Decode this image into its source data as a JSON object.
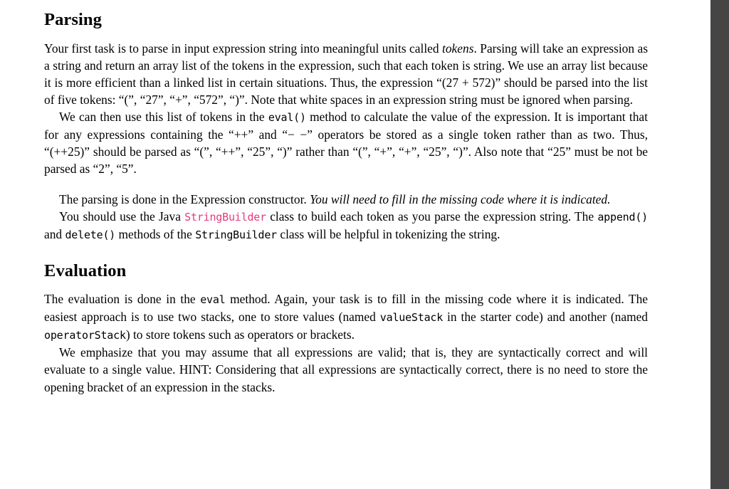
{
  "document": {
    "sections": [
      {
        "heading": "Parsing",
        "paragraphs": [
          {
            "id": "p1",
            "runs": [
              {
                "t": "Your first task is to parse in input expression string into meaningful units called ",
                "s": "normal"
              },
              {
                "t": "tokens",
                "s": "italic"
              },
              {
                "t": ". Parsing will take an expression as a string and return an array list of the tokens in the expression, such that each token is string. We use an array list because it is more efficient than a linked list in certain situations. Thus, the expression “(27 + 572)” should be parsed into the list of five tokens: “(”, “27”, “+”, “572”, “)”. Note that white spaces in an expression string must be ignored when parsing.",
                "s": "normal"
              }
            ]
          },
          {
            "id": "p2",
            "runs": [
              {
                "t": "We can then use this list of tokens in the ",
                "s": "normal"
              },
              {
                "t": "eval()",
                "s": "mono"
              },
              {
                "t": " method to calculate the value of the expression. It is important that for any expressions containing the “++” and “− −” operators be stored as a single token rather than as two. Thus, “(++25)” should be parsed as “(”, “++”, “25”, “)” rather than “(”, “+”, “+”, “25”, “)”. Also note that “25” must be not be parsed as “2”, “5”.",
                "s": "normal"
              }
            ]
          },
          {
            "id": "p3",
            "runs": [
              {
                "t": "The parsing is done in the Expression constructor. ",
                "s": "normal"
              },
              {
                "t": "You will need to fill in the missing code where it is indicated.",
                "s": "italic"
              }
            ]
          },
          {
            "id": "p4",
            "runs": [
              {
                "t": "You should use the Java ",
                "s": "normal"
              },
              {
                "t": "StringBuilder",
                "s": "mono-pink"
              },
              {
                "t": " class to build each token as you parse the expression string. The ",
                "s": "normal"
              },
              {
                "t": "append()",
                "s": "mono"
              },
              {
                "t": " and ",
                "s": "normal"
              },
              {
                "t": "delete()",
                "s": "mono"
              },
              {
                "t": " methods of the ",
                "s": "normal"
              },
              {
                "t": "StringBuilder",
                "s": "mono"
              },
              {
                "t": " class will be helpful in tokenizing the string.",
                "s": "normal"
              }
            ]
          }
        ]
      },
      {
        "heading": "Evaluation",
        "paragraphs": [
          {
            "id": "p5",
            "runs": [
              {
                "t": "The evaluation is done in the ",
                "s": "normal"
              },
              {
                "t": "eval",
                "s": "mono"
              },
              {
                "t": " method. Again, your task is to fill in the missing code where it is indicated. The easiest approach is to use two stacks, one to store values (named ",
                "s": "normal"
              },
              {
                "t": "valueStack",
                "s": "mono"
              },
              {
                "t": " in the starter code) and another (named ",
                "s": "normal"
              },
              {
                "t": "operatorStack",
                "s": "mono"
              },
              {
                "t": ") to store tokens such as operators or brackets.",
                "s": "normal"
              }
            ]
          },
          {
            "id": "p6",
            "runs": [
              {
                "t": "We emphasize that you may assume that all expressions are valid; that is, they are syntactically correct and will evaluate to a single value. HINT: Considering that all expressions are syntactically correct, there is no need to store the opening bracket of an expression in the stacks.",
                "s": "normal"
              }
            ]
          }
        ]
      }
    ]
  },
  "colors": {
    "page_background": "#ffffff",
    "text": "#000000",
    "code_highlight": "#e5397f",
    "right_band": "#454545"
  }
}
